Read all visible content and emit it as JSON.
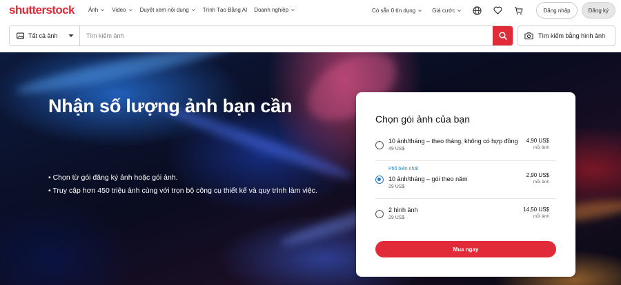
{
  "brand": {
    "logo_text": "shutterstock",
    "accent": "#e12b38"
  },
  "nav": {
    "items": [
      {
        "label": "Ảnh"
      },
      {
        "label": "Video"
      },
      {
        "label": "Duyệt xem nội dung"
      },
      {
        "label": "Trình Tạo Bằng AI"
      },
      {
        "label": "Doanh nghiệp"
      }
    ],
    "credits_label": "Có sẵn 0 tín dụng",
    "pricing_label": "Giá cước",
    "login_label": "Đăng nhập",
    "signup_label": "Đăng ký",
    "icons": [
      "globe-icon",
      "heart-icon",
      "cart-icon"
    ]
  },
  "search": {
    "asset_type": "Tất cả ảnh",
    "placeholder": "Tìm kiếm ảnh",
    "value": "",
    "image_search_label": "Tìm kiếm bằng hình ảnh"
  },
  "hero": {
    "title": "Nhận số lượng ảnh bạn cần",
    "bullets": [
      "• Chọn từ gói đăng ký ảnh hoặc gói ảnh.",
      "• Truy cập hơn 450 triệu ảnh cùng với trọn bộ công cụ thiết kế và quy trình làm việc."
    ]
  },
  "plan_card": {
    "title": "Chọn gói ảnh của bạn",
    "options": [
      {
        "name": "10 ảnh/tháng – theo tháng, không có hợp đồng",
        "sub": "49 US$",
        "price": "4,90 US$",
        "unit": "mỗi ảnh",
        "badge": "",
        "selected": false
      },
      {
        "name": "10 ảnh/tháng – gói theo năm",
        "sub": "29 US$",
        "price": "2,90 US$",
        "unit": "mỗi ảnh",
        "badge": "Phổ biến nhất",
        "selected": true
      },
      {
        "name": "2 hình ảnh",
        "sub": "29 US$",
        "price": "14,50 US$",
        "unit": "mỗi ảnh",
        "badge": "",
        "selected": false
      }
    ],
    "buy_label": "Mua ngay",
    "selected_color": "#2276c9"
  }
}
